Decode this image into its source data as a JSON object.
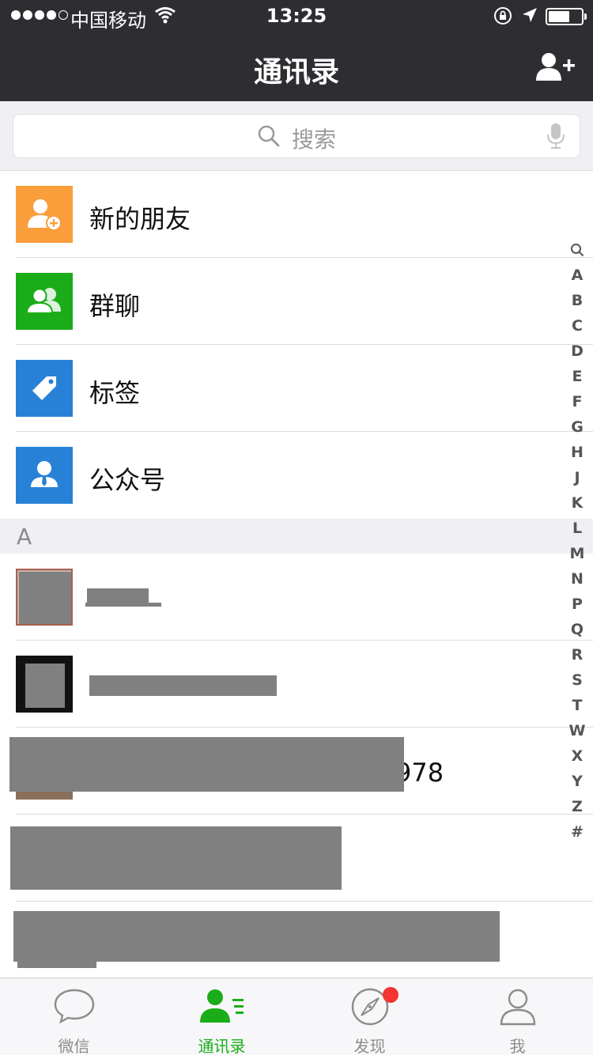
{
  "status_bar": {
    "carrier": "中国移动",
    "time": "13:25",
    "signal_bars": 4
  },
  "nav": {
    "title": "通讯录"
  },
  "search": {
    "placeholder": "搜索"
  },
  "functions": [
    {
      "label": "新的朋友",
      "icon": "new-friend-icon",
      "color": "#fa9d3b"
    },
    {
      "label": "群聊",
      "icon": "group-chat-icon",
      "color": "#1aad19"
    },
    {
      "label": "标签",
      "icon": "tag-icon",
      "color": "#2782d7"
    },
    {
      "label": "公众号",
      "icon": "official-account-icon",
      "color": "#2782d7"
    }
  ],
  "section": {
    "letter": "A"
  },
  "contacts": [
    {
      "name_visible": ""
    },
    {
      "name_visible": ""
    },
    {
      "name_visible": "978"
    },
    {
      "name_visible": ""
    },
    {
      "name_visible": ""
    }
  ],
  "index_letters": [
    "A",
    "B",
    "C",
    "D",
    "E",
    "F",
    "G",
    "H",
    "J",
    "K",
    "L",
    "M",
    "N",
    "P",
    "Q",
    "R",
    "S",
    "T",
    "W",
    "X",
    "Y",
    "Z",
    "#"
  ],
  "tabs": [
    {
      "label": "微信",
      "icon": "chat-bubble-icon",
      "active": false
    },
    {
      "label": "通讯录",
      "icon": "contacts-icon",
      "active": true
    },
    {
      "label": "发现",
      "icon": "compass-icon",
      "active": false,
      "badge": true
    },
    {
      "label": "我",
      "icon": "person-icon",
      "active": false
    }
  ],
  "colors": {
    "header_bg": "#2e2e32",
    "accent_green": "#1aad19",
    "badge_red": "#f43530",
    "page_bg": "#efeff4"
  }
}
